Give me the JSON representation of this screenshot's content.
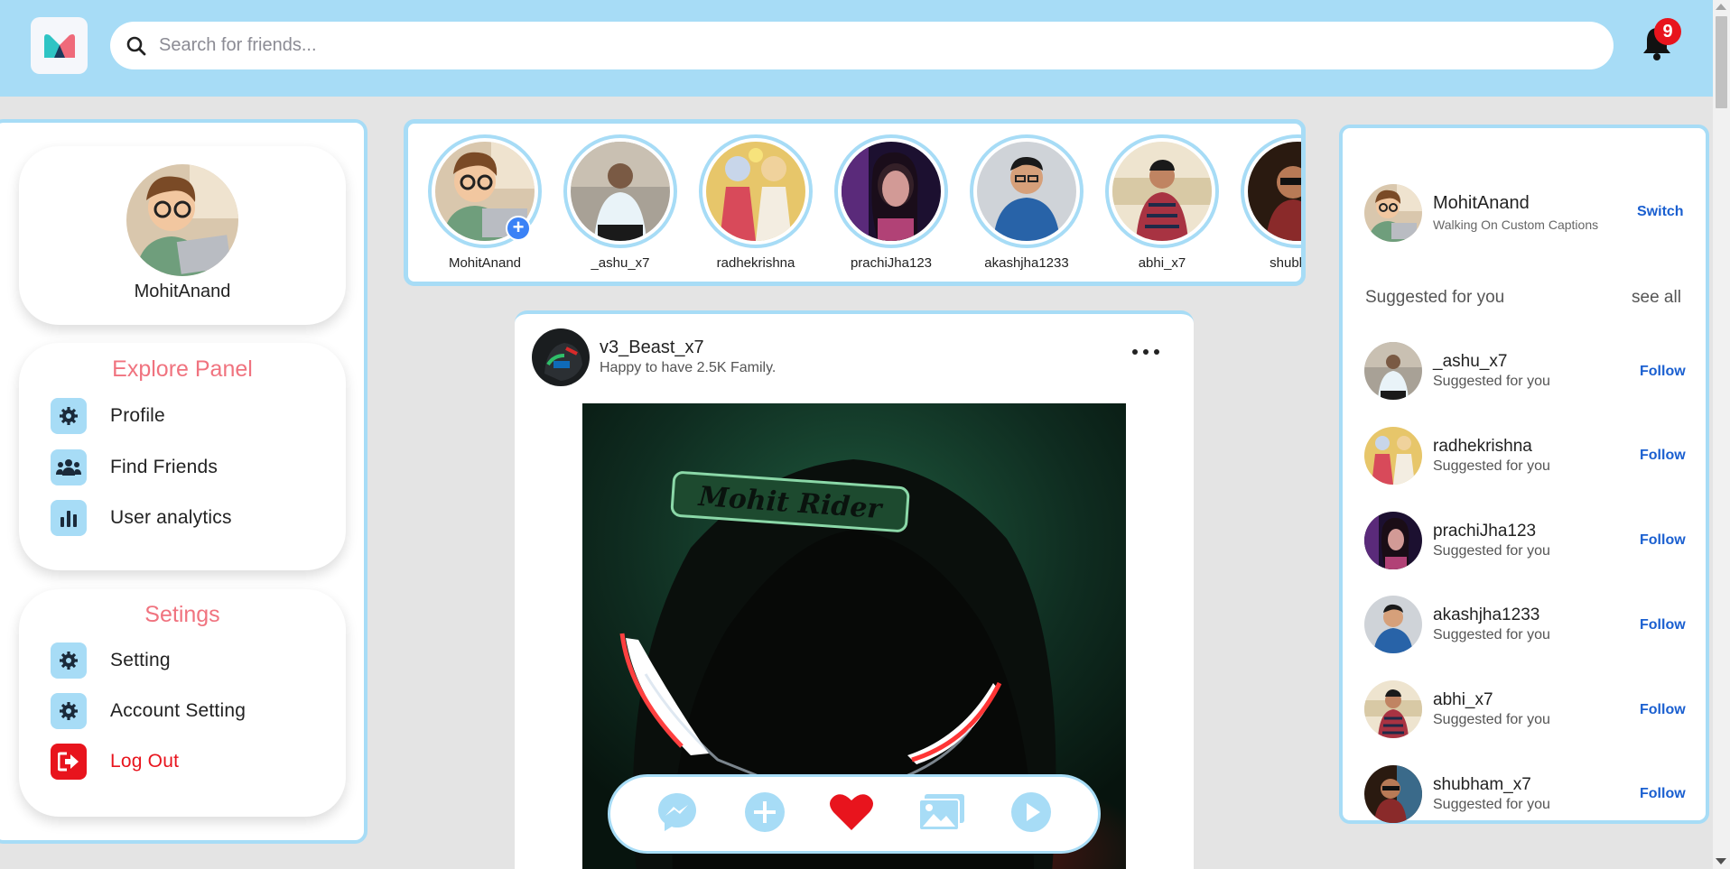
{
  "header": {
    "search_placeholder": "Search for friends...",
    "notification_count": "9"
  },
  "left": {
    "profile_name": "MohitAnand",
    "explore_title": "Explore Panel",
    "explore_items": [
      {
        "label": "Profile",
        "icon": "gear-icon"
      },
      {
        "label": "Find Friends",
        "icon": "users-icon"
      },
      {
        "label": "User analytics",
        "icon": "chart-icon"
      }
    ],
    "settings_title": "Setings",
    "settings_items": [
      {
        "label": "Setting",
        "icon": "gear-icon"
      },
      {
        "label": "Account Setting",
        "icon": "gear-icon"
      },
      {
        "label": "Log Out",
        "icon": "logout-icon"
      }
    ]
  },
  "stories": [
    "MohitAnand",
    "_ashu_x7",
    "radhekrishna",
    "prachiJha123",
    "akashjha1233",
    "abhi_x7",
    "shubham"
  ],
  "post": {
    "username": "v3_Beast_x7",
    "caption": "Happy to have 2.5K Family.",
    "image_text": "Mohit Rider"
  },
  "right": {
    "me_name": "MohitAnand",
    "me_caption": "Walking On Custom Captions",
    "switch_label": "Switch",
    "suggested_title": "Suggested for you",
    "see_all": "see all",
    "follow_label": "Follow",
    "suggestions": [
      {
        "name": "_ashu_x7",
        "sub": "Suggested for you"
      },
      {
        "name": "radhekrishna",
        "sub": "Suggested for you"
      },
      {
        "name": "prachiJha123",
        "sub": "Suggested for you"
      },
      {
        "name": "akashjha1233",
        "sub": "Suggested for you"
      },
      {
        "name": "abhi_x7",
        "sub": "Suggested for you"
      },
      {
        "name": "shubham_x7",
        "sub": "Suggested for you"
      }
    ]
  },
  "colors": {
    "accent": "#a7dcf6",
    "pink_title": "#f0737f",
    "danger": "#e8141d",
    "link": "#1a5fd0"
  }
}
